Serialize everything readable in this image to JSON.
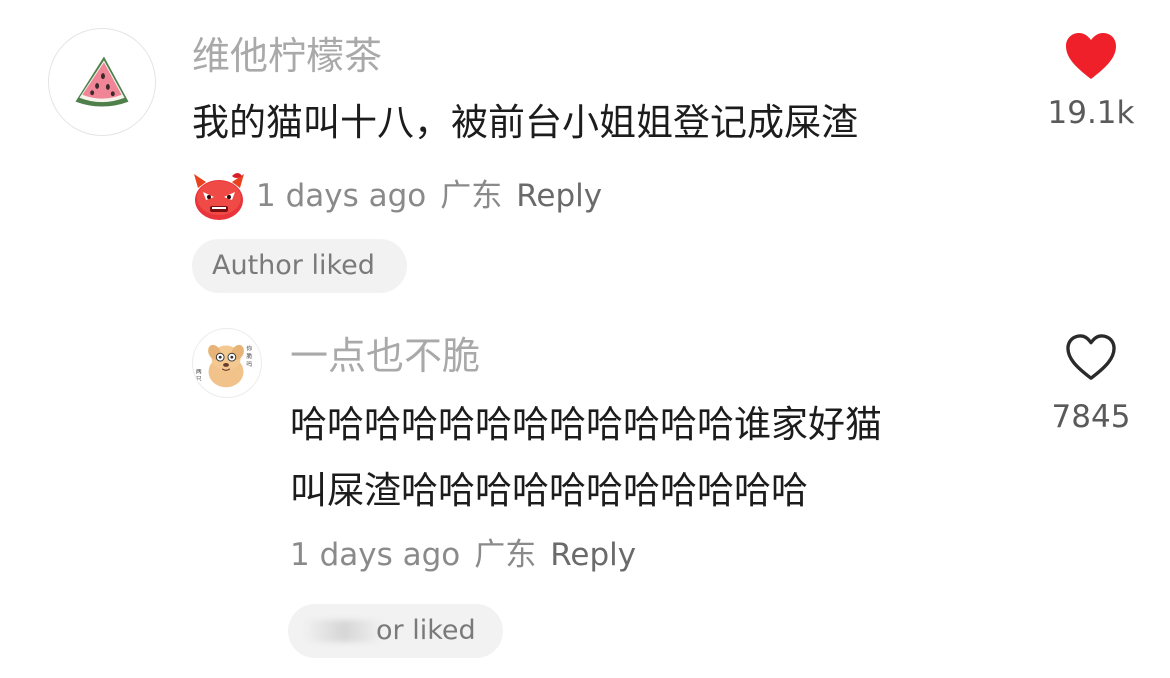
{
  "comments": [
    {
      "username": "维他柠檬茶",
      "avatar_icon": "watermelon-icon",
      "text": "我的猫叫十八，被前台小姐姐登记成屎渣",
      "badge_icon": "angry-face-emoji-icon",
      "time": "1 days ago",
      "location": "广东",
      "reply_label": "Reply",
      "author_liked_label": "Author liked",
      "like_count": "19.1k",
      "liked": true,
      "like_color": "#f0202b"
    },
    {
      "username": "一点也不脆",
      "avatar_icon": "cartoon-dog-avatar-icon",
      "text_lines": [
        "哈哈哈哈哈哈哈哈哈哈哈哈谁家好猫",
        "叫屎渣哈哈哈哈哈哈哈哈哈哈哈"
      ],
      "time": "1 days ago",
      "location": "广东",
      "reply_label": "Reply",
      "author_liked_label": "or liked",
      "like_count": "7845",
      "liked": false
    }
  ]
}
